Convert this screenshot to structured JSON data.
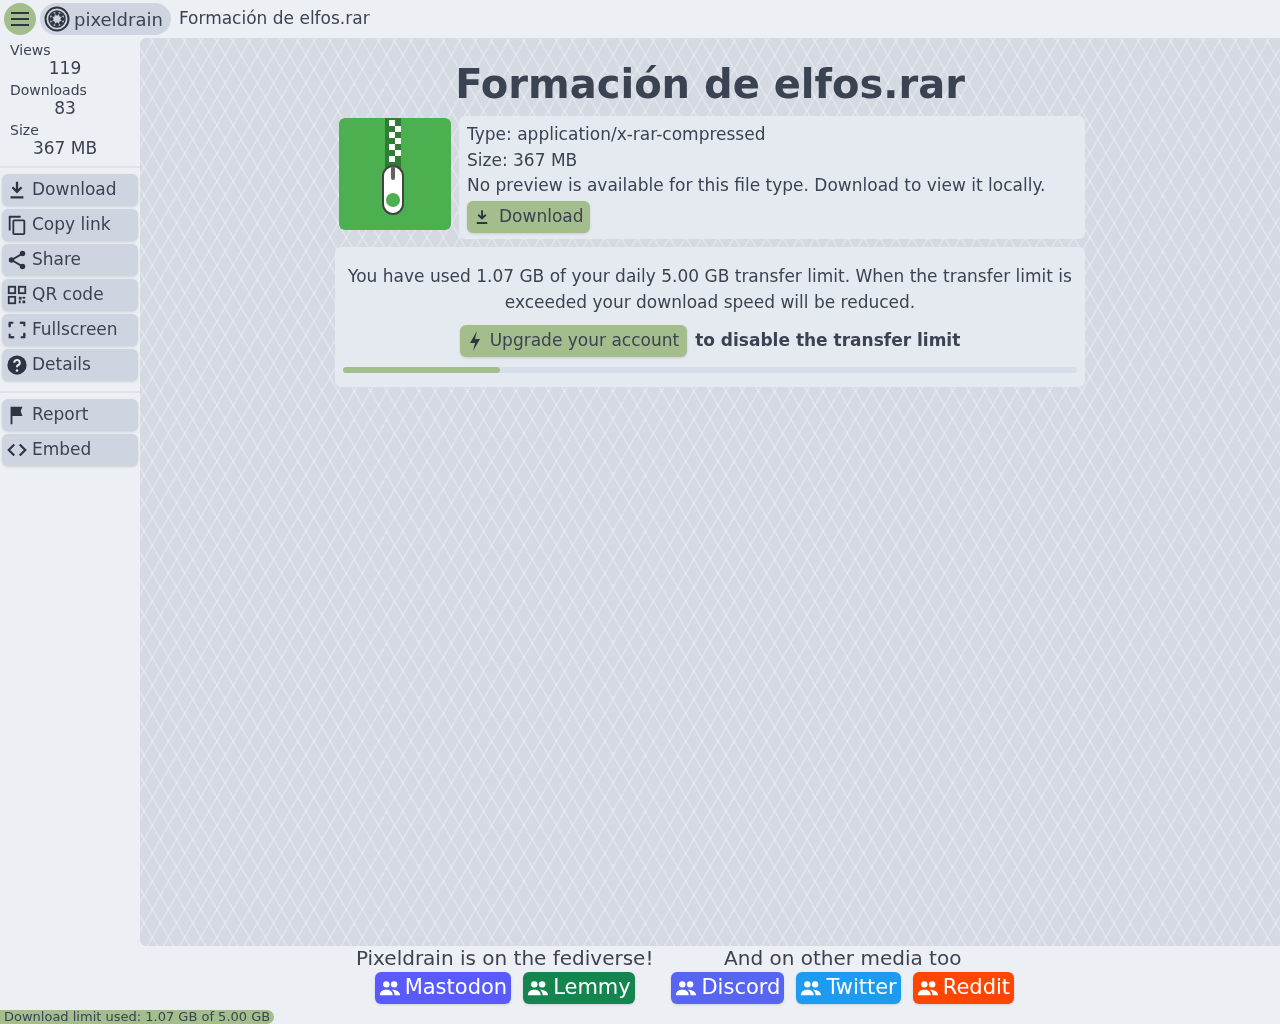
{
  "header": {
    "brand": "pixeldrain",
    "file_name": "Formación de elfos.rar"
  },
  "stats": [
    {
      "label": "Views",
      "value": "119"
    },
    {
      "label": "Downloads",
      "value": "83"
    },
    {
      "label": "Size",
      "value": "367 MB"
    }
  ],
  "sidebar": {
    "groups": [
      [
        {
          "kind": "download",
          "label": "Download"
        },
        {
          "kind": "copy",
          "label": "Copy link"
        },
        {
          "kind": "share",
          "label": "Share"
        },
        {
          "kind": "qr",
          "label": "QR code"
        },
        {
          "kind": "fullscreen",
          "label": "Fullscreen"
        },
        {
          "kind": "details",
          "label": "Details"
        }
      ],
      [
        {
          "kind": "report",
          "label": "Report"
        },
        {
          "kind": "embed",
          "label": "Embed"
        }
      ]
    ]
  },
  "file": {
    "title": "Formación de elfos.rar",
    "type": "Type: application/x-rar-compressed",
    "size": "Size: 367 MB",
    "note": "No preview is available for this file type. Download to view it locally.",
    "download_button": "Download"
  },
  "transfer": {
    "message": "You have used 1.07 GB of your daily 5.00 GB transfer limit. When the transfer limit is exceeded your download speed will be reduced.",
    "upgrade_button": "Upgrade your account",
    "upgrade_note": "to disable the transfer limit",
    "level": 0.214
  },
  "social": [
    {
      "heading": "Pixeldrain is on the fediverse!",
      "links": [
        {
          "label": "Mastodon",
          "color": "#595aff"
        },
        {
          "label": "Lemmy",
          "color": "#14854f"
        }
      ]
    },
    {
      "heading": "And on other media too",
      "links": [
        {
          "label": "Discord",
          "color": "#5865f2"
        },
        {
          "label": "Twitter",
          "color": "#1d9bf0"
        },
        {
          "label": "Reddit",
          "color": "#ff4500"
        }
      ]
    }
  ],
  "status_bar": {
    "text": "Download limit used: 1.07 GB of 5.00 GB",
    "level": 0.214
  }
}
